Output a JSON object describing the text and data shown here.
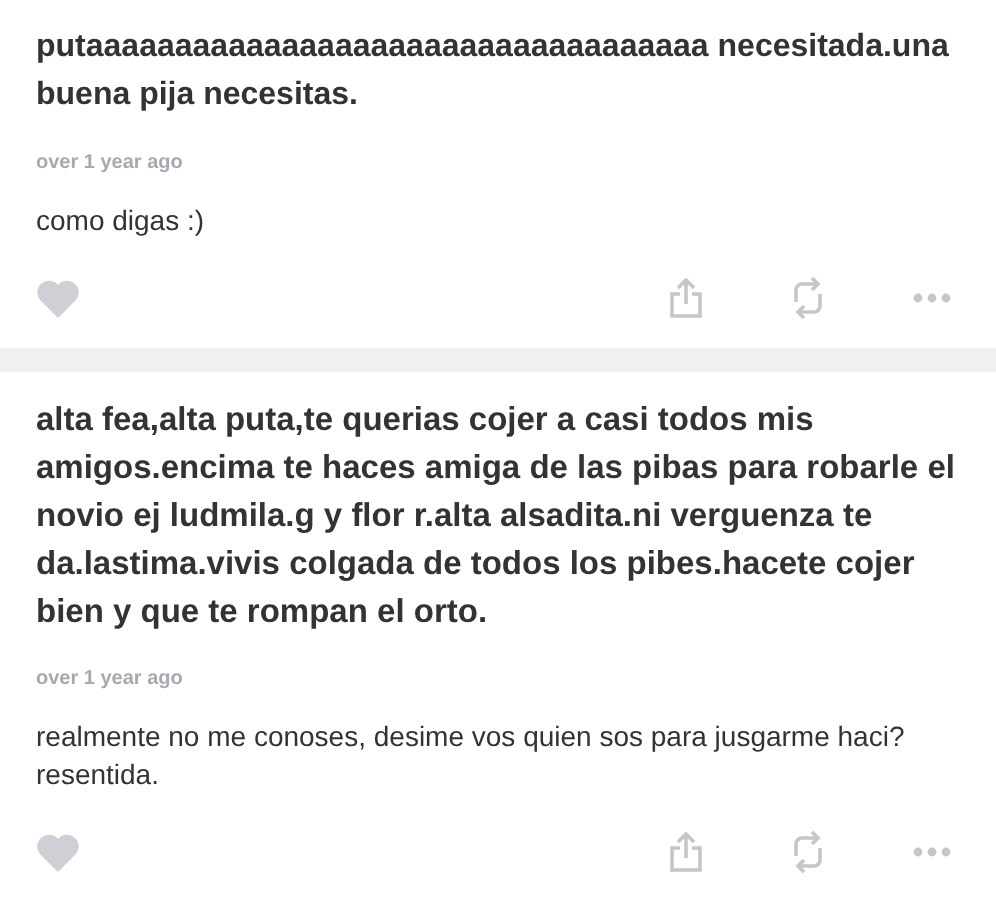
{
  "posts": [
    {
      "question": "putaaaaaaaaaaaaaaaaaaaaaaaaaaaaaaaaaaa necesitada.una buena pija necesitas.",
      "time": "over 1 year ago",
      "answer": "como digas :)"
    },
    {
      "question": "alta fea,alta puta,te querias cojer a casi todos mis amigos.encima te haces amiga de las pibas para robarle el novio ej ludmila.g y flor r.alta alsadita.ni verguenza te da.lastima.vivis colgada de todos los pibes.hacete cojer bien y que te rompan el orto.",
      "time": "over 1 year ago",
      "answer": "realmente no me conoses, desime vos quien sos para jusgarme haci? resentida."
    }
  ]
}
